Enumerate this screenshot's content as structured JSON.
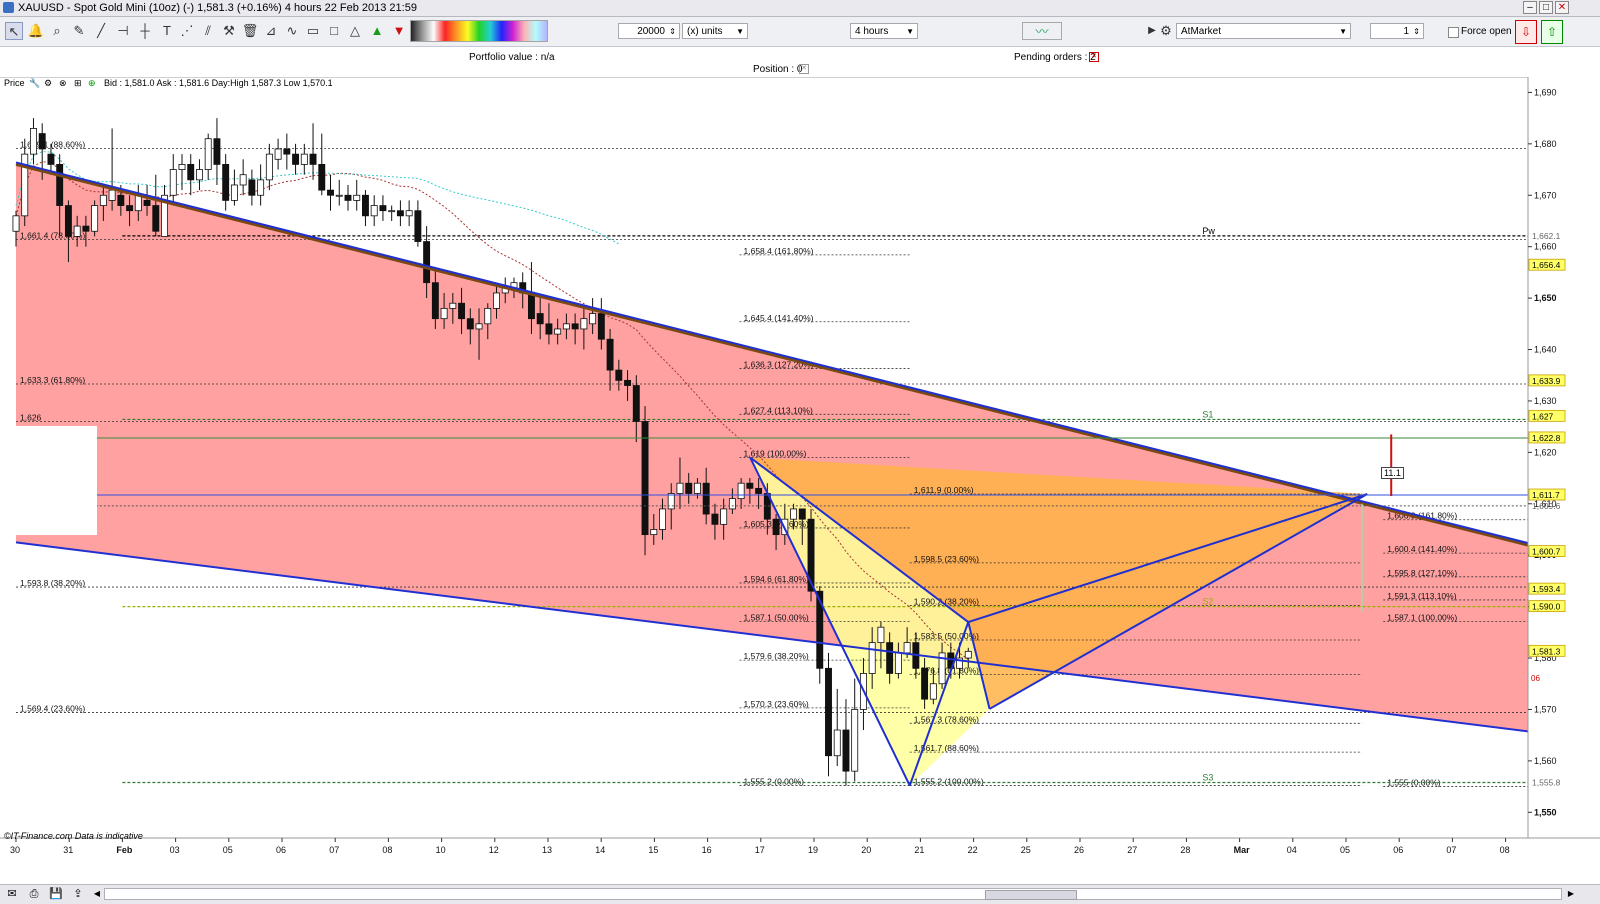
{
  "window": {
    "title": "XAUUSD - Spot Gold Mini (10oz) (-)   1,581.3 (+0.16%)   4 hours  22 Feb 2013 21:59"
  },
  "toolbar": {
    "quantity": "20000",
    "units_label": "(x) units",
    "timeframe": "4 hours",
    "order_type": "AtMarket",
    "lots": "1",
    "force_open_label": "Force open"
  },
  "info_bar": {
    "portfolio_value": "Portfolio value : n/a",
    "position": "Position : 0",
    "pending_orders": "Pending orders : 2"
  },
  "price_panel": {
    "label": "Price",
    "quote": "Bid : 1,581.0 Ask : 1,581.6 Day:High 1,587.3 Low 1,570.1"
  },
  "chart_data": {
    "type": "candlestick",
    "symbol": "XAUUSD",
    "timeframe": "4 hours",
    "y_range": [
      1545,
      1693
    ],
    "y_ticks": [
      "1,690",
      "1,680",
      "1,670",
      "1,660",
      "1,650",
      "1,640",
      "1,630",
      "1,620",
      "1,610",
      "1,600",
      "1,590",
      "1,580",
      "1,570",
      "1,560",
      "1,550"
    ],
    "x_labels": [
      {
        "label": "30",
        "day": 0
      },
      {
        "label": "31",
        "day": 1
      },
      {
        "label": "Feb",
        "day": 2
      },
      {
        "label": "03",
        "day": 3
      },
      {
        "label": "05",
        "day": 4
      },
      {
        "label": "06",
        "day": 5
      },
      {
        "label": "07",
        "day": 6
      },
      {
        "label": "08",
        "day": 7
      },
      {
        "label": "10",
        "day": 8
      },
      {
        "label": "12",
        "day": 9
      },
      {
        "label": "13",
        "day": 10
      },
      {
        "label": "14",
        "day": 11
      },
      {
        "label": "15",
        "day": 12
      },
      {
        "label": "16",
        "day": 13
      },
      {
        "label": "17",
        "day": 14
      },
      {
        "label": "19",
        "day": 15
      },
      {
        "label": "20",
        "day": 16
      },
      {
        "label": "21",
        "day": 17
      },
      {
        "label": "22",
        "day": 18
      },
      {
        "label": "25",
        "day": 19
      },
      {
        "label": "26",
        "day": 20
      },
      {
        "label": "27",
        "day": 21
      },
      {
        "label": "28",
        "day": 22
      },
      {
        "label": "Mar",
        "day": 23
      },
      {
        "label": "04",
        "day": 24
      },
      {
        "label": "05",
        "day": 25
      },
      {
        "label": "06",
        "day": 26
      },
      {
        "label": "07",
        "day": 27
      },
      {
        "label": "08",
        "day": 28
      }
    ],
    "price_markers": [
      {
        "text": "1,662.1",
        "value": 1662.1,
        "highlight": false
      },
      {
        "text": "1,656.4",
        "value": 1656.4,
        "highlight": true
      },
      {
        "text": "1,633.9",
        "value": 1633.9,
        "highlight": true
      },
      {
        "text": "1,627",
        "value": 1627,
        "highlight": true
      },
      {
        "text": "1,622.8",
        "value": 1622.8,
        "highlight": true
      },
      {
        "text": "1,611.7",
        "value": 1611.7,
        "highlight": true
      },
      {
        "text": "1,609.6",
        "value": 1609.6,
        "highlight": false
      },
      {
        "text": "1,600.7",
        "value": 1600.7,
        "highlight": true
      },
      {
        "text": "1,593.4",
        "value": 1593.4,
        "highlight": true
      },
      {
        "text": "1,590.0",
        "value": 1590.0,
        "highlight": true
      },
      {
        "text": "1,581.3",
        "value": 1581.3,
        "highlight": true
      },
      {
        "text": "1,555.8",
        "value": 1555.8,
        "highlight": false
      }
    ],
    "fib_levels": [
      {
        "text": "1,679.1 (88.60%)",
        "value": 1679.1,
        "d0": 0,
        "d1": 28.6
      },
      {
        "text": "1,661.4 (78.60%)",
        "value": 1661.4,
        "d0": 0,
        "d1": 28.6
      },
      {
        "text": "1,633.3 (61.80%)",
        "value": 1633.3,
        "d0": 0,
        "d1": 28.6
      },
      {
        "text": "1,626",
        "value": 1626,
        "d0": 0,
        "d1": 28.6
      },
      {
        "text": "1,593.8 (38.20%)",
        "value": 1593.8,
        "d0": 0,
        "d1": 28.6
      },
      {
        "text": "1,569.4 (23.60%)",
        "value": 1569.4,
        "d0": 0,
        "d1": 28.6
      },
      {
        "text": "1,658.4 (161.80%)",
        "value": 1658.4,
        "d0": 13.6,
        "d1": 16.8
      },
      {
        "text": "1,645.4 (141.40%)",
        "value": 1645.4,
        "d0": 13.6,
        "d1": 16.8
      },
      {
        "text": "1,636.3 (127.20%)",
        "value": 1636.3,
        "d0": 13.6,
        "d1": 16.8
      },
      {
        "text": "1,627.4 (113.10%)",
        "value": 1627.4,
        "d0": 13.6,
        "d1": 16.8
      },
      {
        "text": "1,619 (100.00%)",
        "value": 1619,
        "d0": 13.6,
        "d1": 16.8
      },
      {
        "text": "1,605.3 (78.60%)",
        "value": 1605.3,
        "d0": 13.6,
        "d1": 16.8
      },
      {
        "text": "1,594.6 (61.80%)",
        "value": 1594.6,
        "d0": 13.6,
        "d1": 16.8
      },
      {
        "text": "1,587.1 (50.00%)",
        "value": 1587.1,
        "d0": 13.6,
        "d1": 16.8
      },
      {
        "text": "1,579.6 (38.20%)",
        "value": 1579.6,
        "d0": 13.6,
        "d1": 16.8
      },
      {
        "text": "1,570.3 (23.60%)",
        "value": 1570.3,
        "d0": 13.6,
        "d1": 16.8
      },
      {
        "text": "1,555.2 (0.00%)",
        "value": 1555.2,
        "d0": 13.6,
        "d1": 16.8
      },
      {
        "text": "1,611.9 (0.00%)",
        "value": 1611.9,
        "d0": 16.8,
        "d1": 25.3
      },
      {
        "text": "1,598.5 (23.60%)",
        "value": 1598.5,
        "d0": 16.8,
        "d1": 25.3
      },
      {
        "text": "1,590.2 (38.20%)",
        "value": 1590.2,
        "d0": 16.8,
        "d1": 25.3
      },
      {
        "text": "1,583.5 (50.00%)",
        "value": 1583.5,
        "d0": 16.8,
        "d1": 25.3
      },
      {
        "text": "1,576.8 (61.80%)",
        "value": 1576.8,
        "d0": 16.8,
        "d1": 25.3
      },
      {
        "text": "1,567.3 (78.60%)",
        "value": 1567.3,
        "d0": 16.8,
        "d1": 25.3
      },
      {
        "text": "1,561.7 (88.60%)",
        "value": 1561.7,
        "d0": 16.8,
        "d1": 25.3
      },
      {
        "text": "1,555.2 (100.00%)",
        "value": 1555.2,
        "d0": 16.8,
        "d1": 25.3
      },
      {
        "text": "1,606.9 (161.80%)",
        "value": 1606.9,
        "d0": 25.7,
        "d1": 28.6
      },
      {
        "text": "1,600.4 (141.40%)",
        "value": 1600.4,
        "d0": 25.7,
        "d1": 28.6
      },
      {
        "text": "1,595.8 (127.10%)",
        "value": 1595.8,
        "d0": 25.7,
        "d1": 28.6
      },
      {
        "text": "1,591.3 (113.10%)",
        "value": 1591.3,
        "d0": 25.7,
        "d1": 28.6
      },
      {
        "text": "1,587.1 (100.00%)",
        "value": 1587.1,
        "d0": 25.7,
        "d1": 28.6
      },
      {
        "text": "1,555 (0.00%)",
        "value": 1555,
        "d0": 25.7,
        "d1": 28.6
      }
    ],
    "pivots": [
      {
        "text": "Pw",
        "value": 1662.1,
        "color": "#000000"
      },
      {
        "text": "S1",
        "value": 1626.4,
        "color": "#2e7d32"
      },
      {
        "text": "S2",
        "value": 1590.0,
        "color": "#9ab000"
      },
      {
        "text": "S3",
        "value": 1555.8,
        "color": "#2e7d32"
      }
    ],
    "pattern_points": {
      "X": [
        13.8,
        1619
      ],
      "A": [
        16.8,
        1555.2
      ],
      "B": [
        17.9,
        1587
      ],
      "C": [
        18.3,
        1570.1
      ],
      "D": [
        25.4,
        1611.9
      ]
    },
    "channel": {
      "upper": [
        [
          0,
          1676
        ],
        [
          28.6,
          1601.5
        ]
      ],
      "lower": [
        [
          0,
          1602.5
        ],
        [
          28.6,
          1565.5
        ]
      ]
    },
    "candles": [
      [
        1663,
        1666,
        1660,
        1667
      ],
      [
        1666,
        1678,
        1664,
        1681
      ],
      [
        1678,
        1683,
        1676,
        1685
      ],
      [
        1682,
        1679,
        1673,
        1684
      ],
      [
        1678,
        1676,
        1674,
        1680
      ],
      [
        1676,
        1668,
        1662,
        1678
      ],
      [
        1668,
        1662,
        1657,
        1669
      ],
      [
        1662,
        1664,
        1660,
        1666
      ],
      [
        1664,
        1663,
        1660,
        1666
      ],
      [
        1663,
        1668,
        1662,
        1669
      ],
      [
        1668,
        1670,
        1665,
        1672
      ],
      [
        1669,
        1671,
        1667,
        1683
      ],
      [
        1670,
        1668,
        1666,
        1672
      ],
      [
        1668,
        1667,
        1664,
        1670
      ],
      [
        1667,
        1670,
        1665,
        1672
      ],
      [
        1669,
        1668,
        1666,
        1672
      ],
      [
        1668,
        1663,
        1662,
        1674
      ],
      [
        1662,
        1670,
        1662,
        1672
      ],
      [
        1670,
        1675,
        1668,
        1678
      ],
      [
        1675,
        1676,
        1671,
        1678
      ],
      [
        1676,
        1673,
        1670,
        1678
      ],
      [
        1673,
        1675,
        1671,
        1677
      ],
      [
        1675,
        1681,
        1673,
        1682
      ],
      [
        1681,
        1676,
        1672,
        1685
      ],
      [
        1676,
        1669,
        1667,
        1678
      ],
      [
        1669,
        1672,
        1668,
        1675
      ],
      [
        1672,
        1674,
        1670,
        1677
      ],
      [
        1673,
        1670,
        1668,
        1675
      ],
      [
        1670,
        1673,
        1668,
        1676
      ],
      [
        1673,
        1678,
        1671,
        1680
      ],
      [
        1677,
        1679,
        1675,
        1681
      ],
      [
        1679,
        1678,
        1675,
        1682
      ],
      [
        1678,
        1676,
        1674,
        1680
      ],
      [
        1676,
        1678,
        1674,
        1680
      ],
      [
        1678,
        1676,
        1673,
        1684
      ],
      [
        1676,
        1671,
        1670,
        1682
      ],
      [
        1671,
        1670,
        1667,
        1674
      ],
      [
        1670,
        1670,
        1668,
        1673
      ],
      [
        1670,
        1669,
        1667,
        1672
      ],
      [
        1669,
        1670,
        1667,
        1673
      ],
      [
        1670,
        1666,
        1664,
        1671
      ],
      [
        1666,
        1668,
        1664,
        1670
      ],
      [
        1668,
        1667,
        1665,
        1670
      ],
      [
        1667,
        1667,
        1665,
        1668
      ],
      [
        1667,
        1666,
        1664,
        1669
      ],
      [
        1666,
        1667,
        1664,
        1669
      ],
      [
        1667,
        1661,
        1660,
        1669
      ],
      [
        1661,
        1653,
        1650,
        1664
      ],
      [
        1653,
        1646,
        1644,
        1656
      ],
      [
        1646,
        1648,
        1644,
        1651
      ],
      [
        1648,
        1649,
        1645,
        1651
      ],
      [
        1649,
        1646,
        1643,
        1652
      ],
      [
        1646,
        1644,
        1641,
        1648
      ],
      [
        1644,
        1645,
        1638,
        1648
      ],
      [
        1645,
        1648,
        1642,
        1649
      ],
      [
        1648,
        1651,
        1646,
        1653
      ],
      [
        1651,
        1652,
        1649,
        1654
      ],
      [
        1652,
        1653,
        1650,
        1654
      ],
      [
        1653,
        1651,
        1648,
        1655
      ],
      [
        1651,
        1646,
        1643,
        1657
      ],
      [
        1647,
        1645,
        1642,
        1650
      ],
      [
        1645,
        1643,
        1641,
        1649
      ],
      [
        1643,
        1644,
        1641,
        1646
      ],
      [
        1644,
        1645,
        1642,
        1647
      ],
      [
        1645,
        1644,
        1641,
        1647
      ],
      [
        1644,
        1646,
        1640,
        1648
      ],
      [
        1645,
        1647,
        1643,
        1650
      ],
      [
        1647,
        1642,
        1640,
        1650
      ],
      [
        1642,
        1636,
        1632,
        1644
      ],
      [
        1636,
        1634,
        1632,
        1638
      ],
      [
        1634,
        1633,
        1630,
        1636
      ],
      [
        1633,
        1626,
        1622,
        1635
      ],
      [
        1626,
        1604,
        1600,
        1629
      ],
      [
        1604,
        1605,
        1602,
        1608
      ],
      [
        1605,
        1609,
        1603,
        1611
      ],
      [
        1609,
        1612,
        1605,
        1614
      ],
      [
        1612,
        1614,
        1609,
        1619
      ],
      [
        1614,
        1612,
        1610,
        1616
      ],
      [
        1612,
        1614,
        1611,
        1615
      ],
      [
        1614,
        1608,
        1606,
        1617
      ],
      [
        1608,
        1606,
        1603,
        1610
      ],
      [
        1606,
        1609,
        1603,
        1611
      ],
      [
        1609,
        1611,
        1608,
        1613
      ],
      [
        1611,
        1614,
        1609,
        1615
      ],
      [
        1614,
        1613,
        1610,
        1615
      ],
      [
        1613,
        1612,
        1609,
        1615
      ],
      [
        1612,
        1607,
        1604,
        1614
      ],
      [
        1607,
        1604,
        1601,
        1608
      ],
      [
        1604,
        1607,
        1602,
        1610
      ],
      [
        1607,
        1609,
        1605,
        1610
      ],
      [
        1609,
        1607,
        1602,
        1609
      ],
      [
        1607,
        1593,
        1591,
        1609
      ],
      [
        1593,
        1578,
        1575,
        1594
      ],
      [
        1578,
        1561,
        1557,
        1581
      ],
      [
        1561,
        1566,
        1559,
        1574
      ],
      [
        1566,
        1558,
        1555.2,
        1572
      ],
      [
        1558,
        1570,
        1556,
        1576
      ],
      [
        1570,
        1577,
        1566,
        1580
      ],
      [
        1577,
        1583,
        1574,
        1586
      ],
      [
        1583,
        1586,
        1578,
        1587
      ],
      [
        1583,
        1577,
        1575,
        1585
      ],
      [
        1577,
        1581,
        1576,
        1583
      ],
      [
        1581,
        1583,
        1580,
        1586
      ],
      [
        1583,
        1578,
        1576,
        1585
      ],
      [
        1578,
        1572,
        1570.1,
        1580
      ],
      [
        1572,
        1575,
        1571,
        1578
      ],
      [
        1575,
        1581,
        1574,
        1583
      ],
      [
        1581,
        1578,
        1576,
        1583
      ],
      [
        1578,
        1580,
        1576,
        1583
      ],
      [
        1580,
        1581.3,
        1578,
        1582
      ]
    ]
  },
  "overlay_labels": {
    "box_value": "11.1",
    "copyright": "©IT-Finance.com  Data is indicative",
    "small_badge": "06"
  }
}
